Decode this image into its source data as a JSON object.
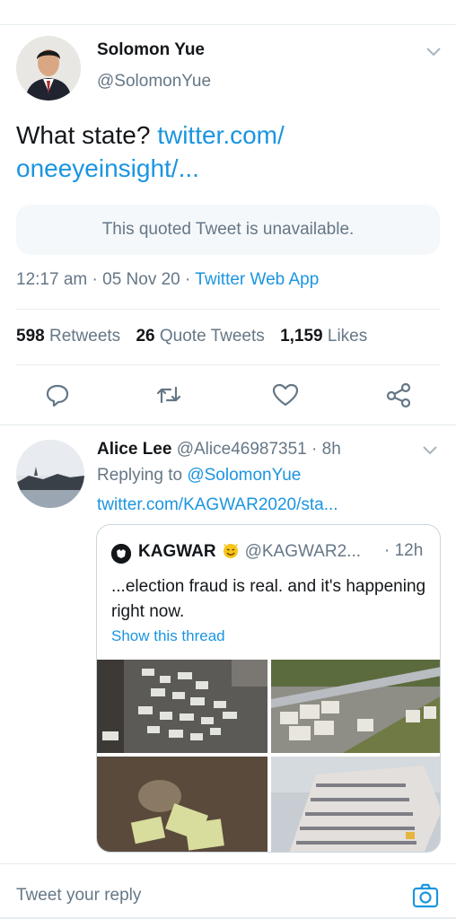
{
  "colors": {
    "link": "#1b95e0",
    "muted": "#657786",
    "text": "#14171a",
    "divider": "#e6ecf0"
  },
  "tweet": {
    "author_name": "Solomon Yue",
    "author_handle": "@SolomonYue",
    "text_prefix": "What state? ",
    "text_link": "twitter.com/ oneeyeinsight/...",
    "quoted_unavailable": "This quoted Tweet is unavailable.",
    "time": "12:17 am",
    "date": "05 Nov 20",
    "app": "Twitter Web App",
    "stats": {
      "retweets_count": "598",
      "retweets_label": "Retweets",
      "quotes_count": "26",
      "quotes_label": "Quote Tweets",
      "likes_count": "1,159",
      "likes_label": "Likes"
    },
    "actions": [
      "reply-icon",
      "retweet-icon",
      "like-icon",
      "share-icon"
    ]
  },
  "reply": {
    "author_name": "Alice Lee",
    "author_handle": "@Alice46987351",
    "time": "8h",
    "replying_prefix": "Replying to ",
    "replying_to": "@SolomonYue",
    "link": "twitter.com/KAGWAR2020/sta...",
    "quote": {
      "author_name": "KAGWAR",
      "author_handle": "@KAGWAR2...",
      "time": "12h",
      "text": "...election fraud is real. and it's happening right now.",
      "show_thread": "Show this thread"
    }
  },
  "composer": {
    "placeholder": "Tweet your reply"
  }
}
